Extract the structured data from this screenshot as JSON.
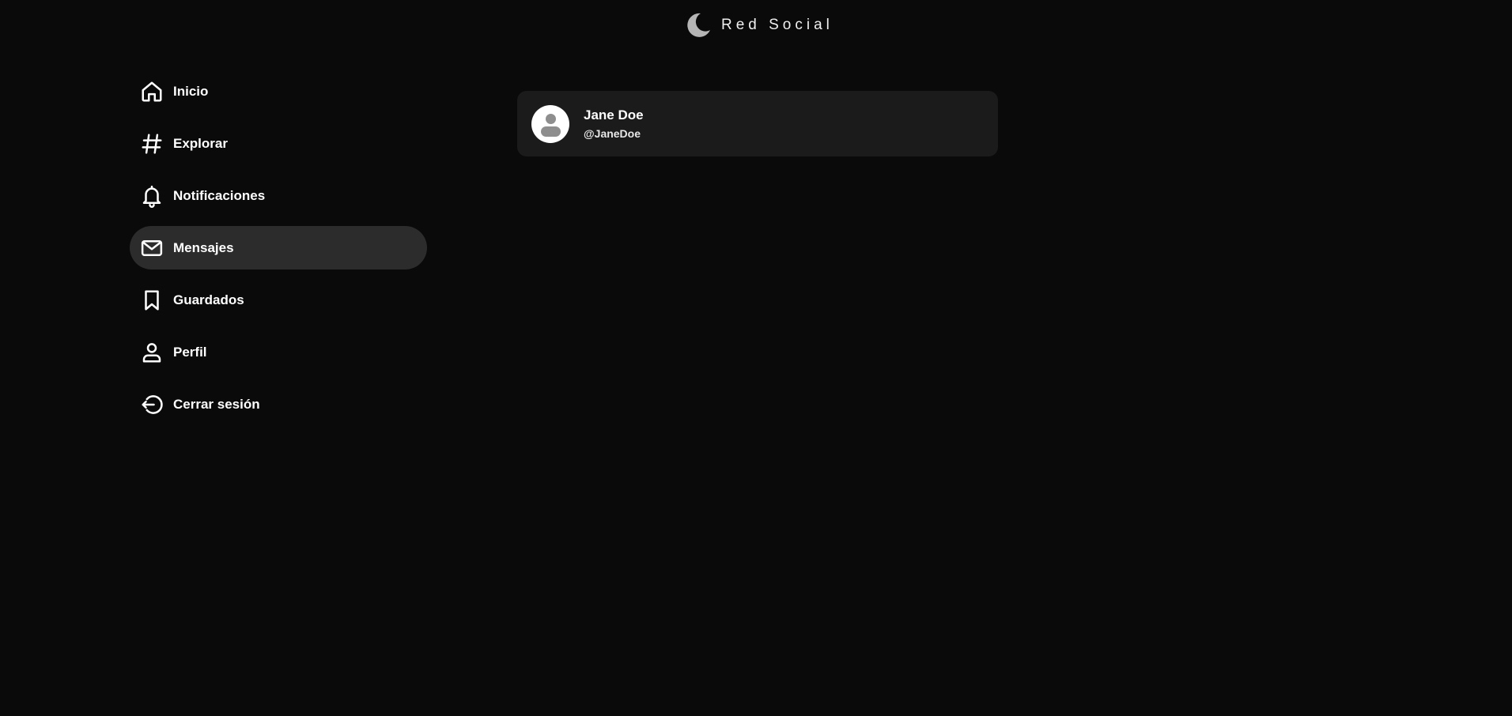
{
  "app": {
    "title": "Red Social",
    "logo_icon": "moon-icon",
    "logo_color": "#b5b5b5"
  },
  "sidebar": {
    "active_background": "#2c2c2c",
    "items": [
      {
        "label": "Inicio",
        "icon": "home-icon",
        "active": false
      },
      {
        "label": "Explorar",
        "icon": "hashtag-icon",
        "active": false
      },
      {
        "label": "Notificaciones",
        "icon": "bell-icon",
        "active": false
      },
      {
        "label": "Mensajes",
        "icon": "mail-icon",
        "active": true
      },
      {
        "label": "Guardados",
        "icon": "bookmark-icon",
        "active": false
      },
      {
        "label": "Perfil",
        "icon": "user-icon",
        "active": false
      },
      {
        "label": "Cerrar sesión",
        "icon": "logout-icon",
        "active": false
      }
    ]
  },
  "messages": {
    "conversations": [
      {
        "name": "Jane Doe",
        "handle": "@JaneDoe",
        "avatar_icon": "default-avatar-icon"
      }
    ]
  },
  "colors": {
    "background": "#0a0a0a",
    "card": "#1b1b1b",
    "text": "#ffffff"
  }
}
